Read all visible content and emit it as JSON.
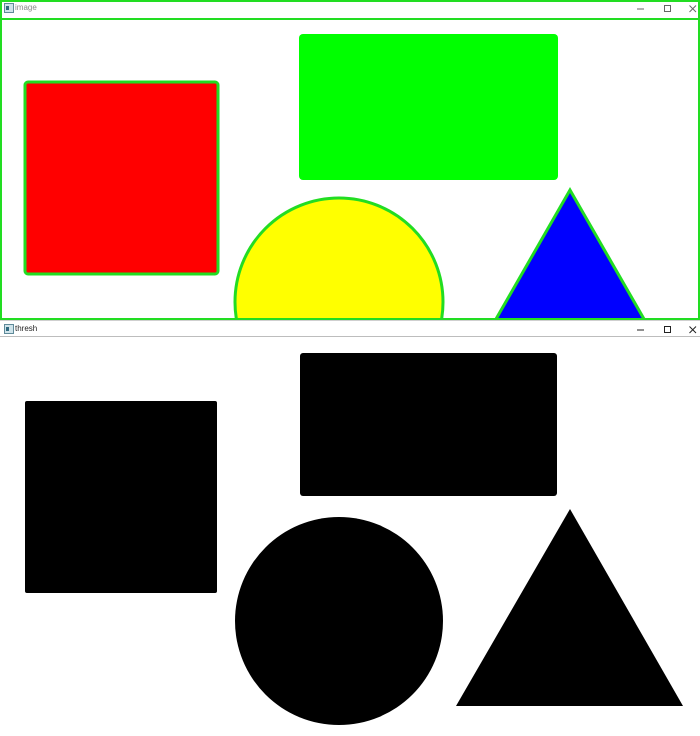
{
  "windows": [
    {
      "title": "image",
      "icon": "app-window-icon",
      "controls": {
        "minimize": "minimize-icon",
        "maximize": "maximize-icon",
        "close": "close-icon"
      },
      "focused": true,
      "accent_color": "#00ff00"
    },
    {
      "title": "thresh",
      "icon": "app-window-icon",
      "controls": {
        "minimize": "minimize-icon",
        "maximize": "maximize-icon",
        "close": "close-icon"
      },
      "focused": false
    }
  ],
  "colors": {
    "square": "#ff0000",
    "rectangle": "#00ff00",
    "circle": "#ffff00",
    "triangle": "#0000ff",
    "contour": "#00ff00",
    "threshold_fill": "#000000",
    "background": "#ffffff"
  }
}
